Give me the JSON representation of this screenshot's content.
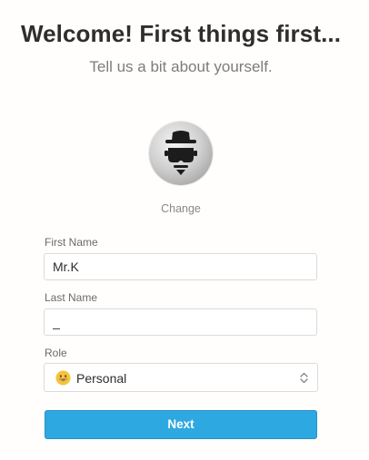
{
  "header": {
    "title": "Welcome! First things first...",
    "subtitle": "Tell us a bit about yourself."
  },
  "avatar": {
    "icon": "incognito-avatar-icon",
    "change_label": "Change"
  },
  "form": {
    "first_name": {
      "label": "First Name",
      "value": "Mr.K"
    },
    "last_name": {
      "label": "Last Name",
      "value": "_"
    },
    "role": {
      "label": "Role",
      "selected_icon": "grinning-face-emoji-icon",
      "selected": "Personal"
    },
    "submit_label": "Next"
  },
  "colors": {
    "background": "#fffefc",
    "accent": "#2ea8e0",
    "title": "#2f2e2b",
    "muted": "#7e7c78"
  }
}
